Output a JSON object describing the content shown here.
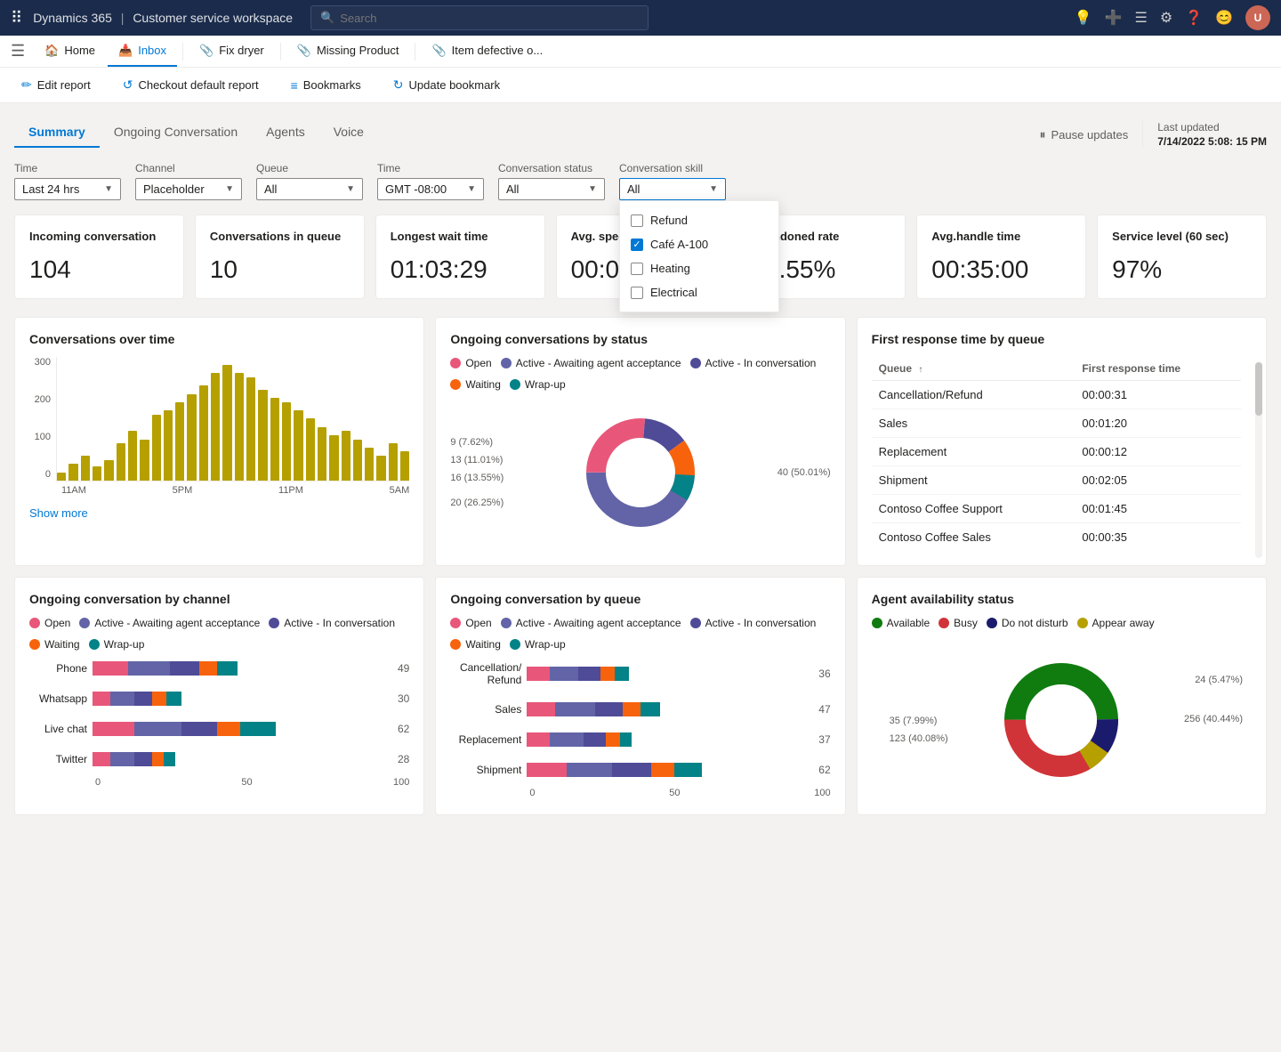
{
  "topNav": {
    "appName": "Dynamics 365",
    "appModule": "Customer service workspace",
    "searchPlaceholder": "Search"
  },
  "tabs": [
    {
      "id": "home",
      "label": "Home",
      "icon": "🏠"
    },
    {
      "id": "inbox",
      "label": "Inbox",
      "icon": "📥"
    },
    {
      "id": "fix-dryer",
      "label": "Fix dryer",
      "icon": "📎"
    },
    {
      "id": "missing-product",
      "label": "Missing Product",
      "icon": "📎"
    },
    {
      "id": "item-defective",
      "label": "Item defective o...",
      "icon": "📎"
    }
  ],
  "toolbar": {
    "editReport": "Edit report",
    "checkoutDefault": "Checkout default report",
    "bookmarks": "Bookmarks",
    "updateBookmark": "Update bookmark"
  },
  "pageTabs": [
    "Summary",
    "Ongoing Conversation",
    "Agents",
    "Voice"
  ],
  "activeTab": "Summary",
  "pauseUpdates": "Pause updates",
  "lastUpdated": {
    "label": "Last updated",
    "value": "7/14/2022 5:08: 15 PM"
  },
  "filters": {
    "time": {
      "label": "Time",
      "value": "Last 24 hrs"
    },
    "channel": {
      "label": "Channel",
      "value": "Placeholder"
    },
    "queue": {
      "label": "Queue",
      "value": "All"
    },
    "timeZone": {
      "label": "Time",
      "value": "GMT -08:00"
    },
    "convStatus": {
      "label": "Conversation status",
      "value": "All"
    },
    "convSkill": {
      "label": "Conversation skill",
      "value": "All",
      "isOpen": true,
      "options": [
        {
          "label": "Refund",
          "checked": false
        },
        {
          "label": "Café A-100",
          "checked": true
        },
        {
          "label": "Heating",
          "checked": false
        },
        {
          "label": "Electrical",
          "checked": false
        }
      ]
    }
  },
  "kpis": [
    {
      "id": "incoming",
      "title": "Incoming conversation",
      "value": "104"
    },
    {
      "id": "in-queue",
      "title": "Conversations in queue",
      "value": "10"
    },
    {
      "id": "longest-wait",
      "title": "Longest wait time",
      "value": "01:03:29"
    },
    {
      "id": "avg-speed",
      "title": "Avg. speed to answer",
      "value": "00:09:19"
    },
    {
      "id": "abandoned",
      "title": "Abandoned rate",
      "value": "12.55%"
    },
    {
      "id": "avg-handle",
      "title": "Avg.handle time",
      "value": "00:35:00"
    },
    {
      "id": "service-level",
      "title": "Service level (60 sec)",
      "value": "97%"
    }
  ],
  "convOverTime": {
    "title": "Conversations over time",
    "yLabels": [
      "300",
      "200",
      "100",
      "0"
    ],
    "xLabels": [
      "11AM",
      "5PM",
      "11PM",
      "5AM"
    ],
    "bars": [
      20,
      40,
      60,
      35,
      50,
      90,
      120,
      100,
      160,
      170,
      190,
      210,
      230,
      260,
      280,
      260,
      250,
      220,
      200,
      190,
      170,
      150,
      130,
      110,
      120,
      100,
      80,
      60,
      90,
      70
    ],
    "showMore": "Show more"
  },
  "ongoingByStatus": {
    "title": "Ongoing conversations by status",
    "legend": [
      {
        "label": "Open",
        "color": "#e8577a"
      },
      {
        "label": "Active - Awaiting agent acceptance",
        "color": "#6264a7"
      },
      {
        "label": "Active - In conversation",
        "color": "#4f4b97"
      },
      {
        "label": "Waiting",
        "color": "#f7630c"
      },
      {
        "label": "Wrap-up",
        "color": "#038387"
      }
    ],
    "segments": [
      {
        "label": "40 (50.01%)",
        "value": 40,
        "pct": 50.01,
        "color": "#6264a7"
      },
      {
        "label": "20 (26.25%)",
        "value": 20,
        "pct": 26.25,
        "color": "#e8577a"
      },
      {
        "label": "16 (13.55%)",
        "value": 16,
        "pct": 13.55,
        "color": "#4f4b97"
      },
      {
        "label": "13 (11.01%)",
        "value": 13,
        "pct": 11.01,
        "color": "#f7630c"
      },
      {
        "label": "9 (7.62%)",
        "value": 9,
        "pct": 7.62,
        "color": "#038387"
      }
    ]
  },
  "firstResponseByQueue": {
    "title": "First response time by queue",
    "columns": [
      "Queue",
      "First response time"
    ],
    "rows": [
      {
        "queue": "Cancellation/Refund",
        "time": "00:00:31"
      },
      {
        "queue": "Sales",
        "time": "00:01:20"
      },
      {
        "queue": "Replacement",
        "time": "00:00:12"
      },
      {
        "queue": "Shipment",
        "time": "00:02:05"
      },
      {
        "queue": "Contoso Coffee Support",
        "time": "00:01:45"
      },
      {
        "queue": "Contoso Coffee Sales",
        "time": "00:00:35"
      }
    ]
  },
  "ongoingByChannel": {
    "title": "Ongoing conversation by channel",
    "legend": [
      {
        "label": "Open",
        "color": "#e8577a"
      },
      {
        "label": "Active - Awaiting agent acceptance",
        "color": "#6264a7"
      },
      {
        "label": "Active - In conversation",
        "color": "#4f4b97"
      },
      {
        "label": "Waiting",
        "color": "#f7630c"
      },
      {
        "label": "Wrap-up",
        "color": "#038387"
      }
    ],
    "channels": [
      {
        "name": "Phone",
        "total": 49,
        "segs": [
          12,
          14,
          10,
          6,
          7
        ]
      },
      {
        "name": "Whatsapp",
        "total": 30,
        "segs": [
          6,
          8,
          6,
          5,
          5
        ]
      },
      {
        "name": "Live chat",
        "total": 62,
        "segs": [
          14,
          16,
          12,
          8,
          12
        ]
      },
      {
        "name": "Twitter",
        "total": 28,
        "segs": [
          6,
          8,
          6,
          4,
          4
        ]
      }
    ],
    "xLabels": [
      "0",
      "50",
      "100"
    ]
  },
  "ongoingByQueue": {
    "title": "Ongoing conversation by queue",
    "legend": [
      {
        "label": "Open",
        "color": "#e8577a"
      },
      {
        "label": "Active - Awaiting agent acceptance",
        "color": "#6264a7"
      },
      {
        "label": "Active - In conversation",
        "color": "#4f4b97"
      },
      {
        "label": "Waiting",
        "color": "#f7630c"
      },
      {
        "label": "Wrap-up",
        "color": "#038387"
      }
    ],
    "queues": [
      {
        "name": "Cancellation/ Refund",
        "total": 36,
        "segs": [
          8,
          10,
          8,
          5,
          5
        ]
      },
      {
        "name": "Sales",
        "total": 47,
        "segs": [
          10,
          14,
          10,
          6,
          7
        ]
      },
      {
        "name": "Replacement",
        "total": 37,
        "segs": [
          8,
          12,
          8,
          5,
          4
        ]
      },
      {
        "name": "Shipment",
        "total": 62,
        "segs": [
          14,
          16,
          14,
          8,
          10
        ]
      }
    ],
    "xLabels": [
      "0",
      "50",
      "100"
    ]
  },
  "agentAvailability": {
    "title": "Agent availability status",
    "legend": [
      {
        "label": "Available",
        "color": "#107c10"
      },
      {
        "label": "Busy",
        "color": "#d13438"
      },
      {
        "label": "Do not disturb",
        "color": "#1b1b6e"
      },
      {
        "label": "Appear away",
        "color": "#b5a000"
      }
    ],
    "segments": [
      {
        "label": "256 (40.44%)",
        "value": 256,
        "pct": 40.44,
        "color": "#d13438"
      },
      {
        "label": "123 (40.08%)",
        "value": 123,
        "pct": 40.08,
        "color": "#107c10"
      },
      {
        "label": "35 (7.99%)",
        "value": 35,
        "pct": 7.99,
        "color": "#1b1b6e"
      },
      {
        "label": "24 (5.47%)",
        "value": 24,
        "pct": 5.47,
        "color": "#b5a000"
      }
    ]
  }
}
